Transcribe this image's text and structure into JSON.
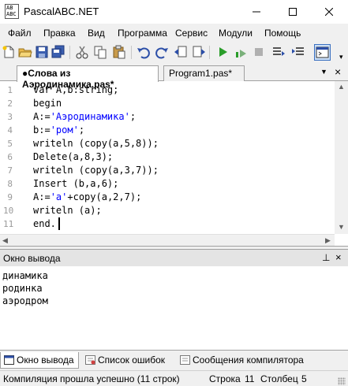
{
  "window": {
    "title": "PascalABC.NET",
    "icon_text": "AB ABC",
    "icons": [
      "app-icon",
      "minimize-icon",
      "maximize-icon",
      "close-icon"
    ]
  },
  "menu": [
    "Файл",
    "Правка",
    "Вид",
    "Программа",
    "Сервис",
    "Модули",
    "Помощь"
  ],
  "toolbar": {
    "icons": [
      "new-file-icon",
      "open-file-icon",
      "save-icon",
      "save-all-icon",
      "cut-icon",
      "copy-icon",
      "paste-icon",
      "undo-icon",
      "redo-icon",
      "navigate-back-icon",
      "navigate-forward-icon",
      "format-code-icon",
      "run-icon",
      "compile-icon",
      "stop-icon",
      "step-over-icon",
      "step-into-icon",
      "output-window-icon"
    ]
  },
  "tabs": [
    {
      "label": "●Слова из Аэродинамика.pas*",
      "active": true
    },
    {
      "label": "Program1.pas*",
      "active": false
    }
  ],
  "tab_controls": {
    "dropdown": "▼",
    "close": "×"
  },
  "editor": {
    "line_numbers": [
      "1",
      "2",
      "3",
      "4",
      "5",
      "6",
      "7",
      "8",
      "9",
      "10",
      "11"
    ],
    "lines": [
      "var A,b:string;",
      "begin",
      "A:='Аэродинамика';",
      "b:='ром';",
      "writeln (copy(a,5,8));",
      "Delete(a,8,3);",
      "writeln (copy(a,3,7));",
      "Insert (b,a,6);",
      "A:='a'+copy(a,2,7);",
      "writeln (a);",
      "end."
    ]
  },
  "output": {
    "title": "Окно вывода",
    "pin": "⊥",
    "close": "×",
    "lines": [
      "динамика",
      "родинка",
      "аэродром"
    ]
  },
  "bottom_tabs": [
    {
      "label": "Окно вывода",
      "icon": "output-window-icon"
    },
    {
      "label": "Список ошибок",
      "icon": "error-list-icon"
    },
    {
      "label": "Сообщения компилятора",
      "icon": "compiler-messages-icon"
    }
  ],
  "status": {
    "message": "Компиляция прошла успешно (11 строк)",
    "row_label": "Строка",
    "row_value": "11",
    "col_label": "Столбец",
    "col_value": "5"
  },
  "colors": {
    "string_literal": "#0000ff",
    "line_number": "#9a9a9a",
    "run_green": "#2a9d2a"
  }
}
